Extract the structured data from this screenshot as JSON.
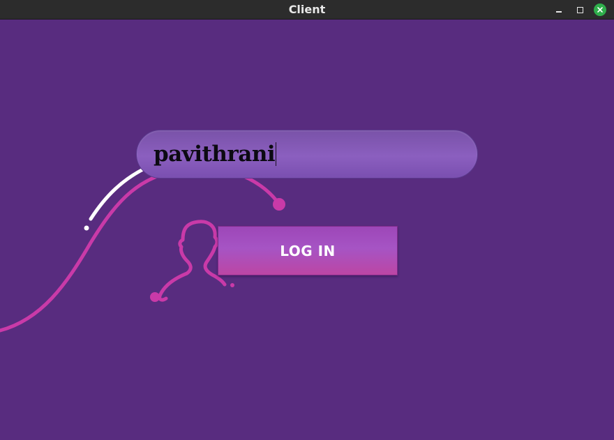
{
  "window": {
    "title": "Client"
  },
  "login_form": {
    "username_value": "pavithrani",
    "login_button_label": "LOG IN"
  },
  "colors": {
    "background": "#582c7f",
    "accent_magenta": "#c93aa8",
    "button": "#a654c4",
    "close_button": "#2fae4b"
  },
  "icons": {
    "user": "user-silhouette-icon"
  }
}
